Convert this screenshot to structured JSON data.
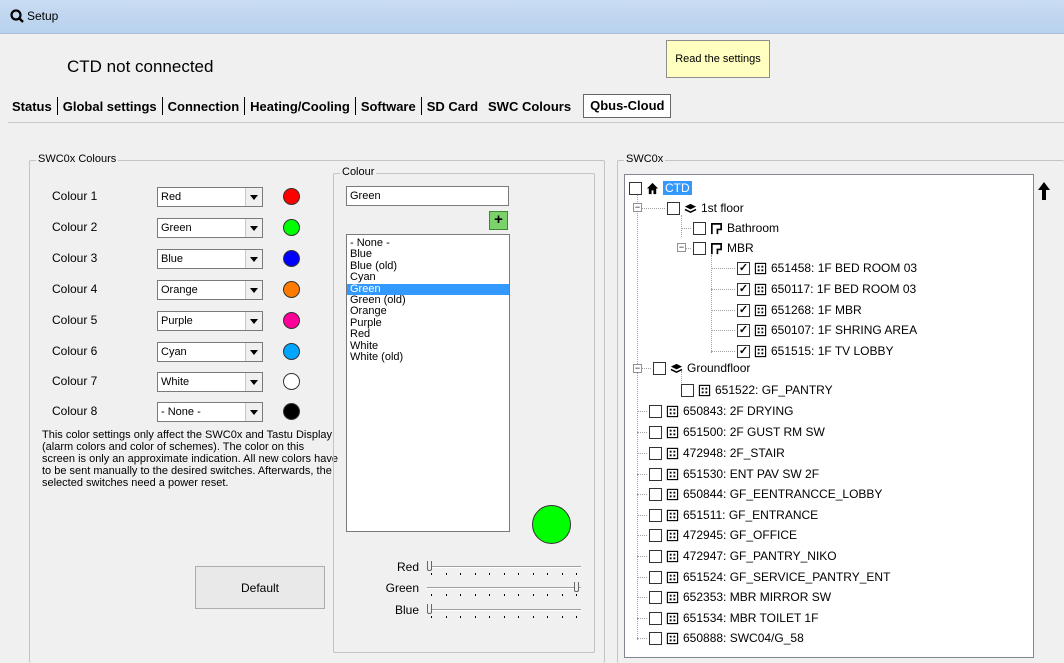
{
  "window": {
    "title": "Setup"
  },
  "status_text": "CTD not connected",
  "read_button": "Read the settings",
  "tabs": [
    "Status",
    "Global settings",
    "Connection",
    "Heating/Cooling",
    "Software",
    "SD Card",
    "SWC Colours",
    "Qbus-Cloud"
  ],
  "active_tab": "SWC Colours",
  "swc_colours": {
    "group_title": "SWC0x Colours",
    "rows": [
      {
        "label": "Colour 1",
        "value": "Red",
        "color": "#ff0000"
      },
      {
        "label": "Colour 2",
        "value": "Green",
        "color": "#00ff00"
      },
      {
        "label": "Colour 3",
        "value": "Blue",
        "color": "#0000ff"
      },
      {
        "label": "Colour 4",
        "value": "Orange",
        "color": "#ff7a00"
      },
      {
        "label": "Colour 5",
        "value": "Purple",
        "color": "#ff0099"
      },
      {
        "label": "Colour 6",
        "value": "Cyan",
        "color": "#00a6ff"
      },
      {
        "label": "Colour 7",
        "value": "White",
        "color": "#ffffff"
      },
      {
        "label": "Colour 8",
        "value": "- None -",
        "color": "#000000"
      }
    ],
    "note": "This color settings only affect the SWC0x and Tastu Display (alarm colors and color of schemes). The color on this screen is only an approximate indication. All new colors have to be sent manually to the desired switches. Afterwards, the selected switches need a power reset.",
    "default_button": "Default"
  },
  "colour_panel": {
    "group_title": "Colour",
    "name_value": "Green",
    "add_icon": "plus-icon",
    "list": [
      "- None -",
      "Blue",
      "Blue (old)",
      "Cyan",
      "Green",
      "Green (old)",
      "Orange",
      "Purple",
      "Red",
      "White",
      "White (old)"
    ],
    "selected": "Green",
    "preview_color": "#00ff00",
    "sliders": [
      {
        "label": "Red",
        "value": 0
      },
      {
        "label": "Green",
        "value": 255
      },
      {
        "label": "Blue",
        "value": 0
      }
    ]
  },
  "swc0x": {
    "group_title": "SWC0x",
    "root": "CTD",
    "up_icon": "arrow-up-icon",
    "nodes": [
      {
        "label": "1st floor",
        "icon": "layers-icon",
        "checked": false
      },
      {
        "label": "Bathroom",
        "icon": "room-icon",
        "checked": false
      },
      {
        "label": "MBR",
        "icon": "room-icon",
        "checked": false
      },
      {
        "label": "651458: 1F BED ROOM 03",
        "icon": "switch-icon",
        "checked": true
      },
      {
        "label": "650117: 1F BED ROOM 03",
        "icon": "switch-icon",
        "checked": true
      },
      {
        "label": "651268: 1F MBR",
        "icon": "switch-icon",
        "checked": true
      },
      {
        "label": "650107: 1F SHRING AREA",
        "icon": "switch-icon",
        "checked": true
      },
      {
        "label": "651515: 1F TV LOBBY",
        "icon": "switch-icon",
        "checked": true
      },
      {
        "label": "Groundfloor",
        "icon": "layers-icon",
        "checked": false
      },
      {
        "label": "651522: GF_PANTRY",
        "icon": "switch-icon",
        "checked": false
      },
      {
        "label": "650843: 2F DRYING",
        "icon": "switch-icon",
        "checked": false
      },
      {
        "label": "651500: 2F GUST RM SW",
        "icon": "switch-icon",
        "checked": false
      },
      {
        "label": "472948: 2F_STAIR",
        "icon": "switch-icon",
        "checked": false
      },
      {
        "label": "651530: ENT PAV SW 2F",
        "icon": "switch-icon",
        "checked": false
      },
      {
        "label": "650844: GF_EENTRANCCE_LOBBY",
        "icon": "switch-icon",
        "checked": false
      },
      {
        "label": "651511: GF_ENTRANCE",
        "icon": "switch-icon",
        "checked": false
      },
      {
        "label": "472945: GF_OFFICE",
        "icon": "switch-icon",
        "checked": false
      },
      {
        "label": "472947: GF_PANTRY_NIKO",
        "icon": "switch-icon",
        "checked": false
      },
      {
        "label": "651524: GF_SERVICE_PANTRY_ENT",
        "icon": "switch-icon",
        "checked": false
      },
      {
        "label": "652353: MBR MIRROR SW",
        "icon": "switch-icon",
        "checked": false
      },
      {
        "label": "651534: MBR TOILET 1F",
        "icon": "switch-icon",
        "checked": false
      },
      {
        "label": "650888: SWC04/G_58",
        "icon": "switch-icon",
        "checked": false
      }
    ]
  }
}
